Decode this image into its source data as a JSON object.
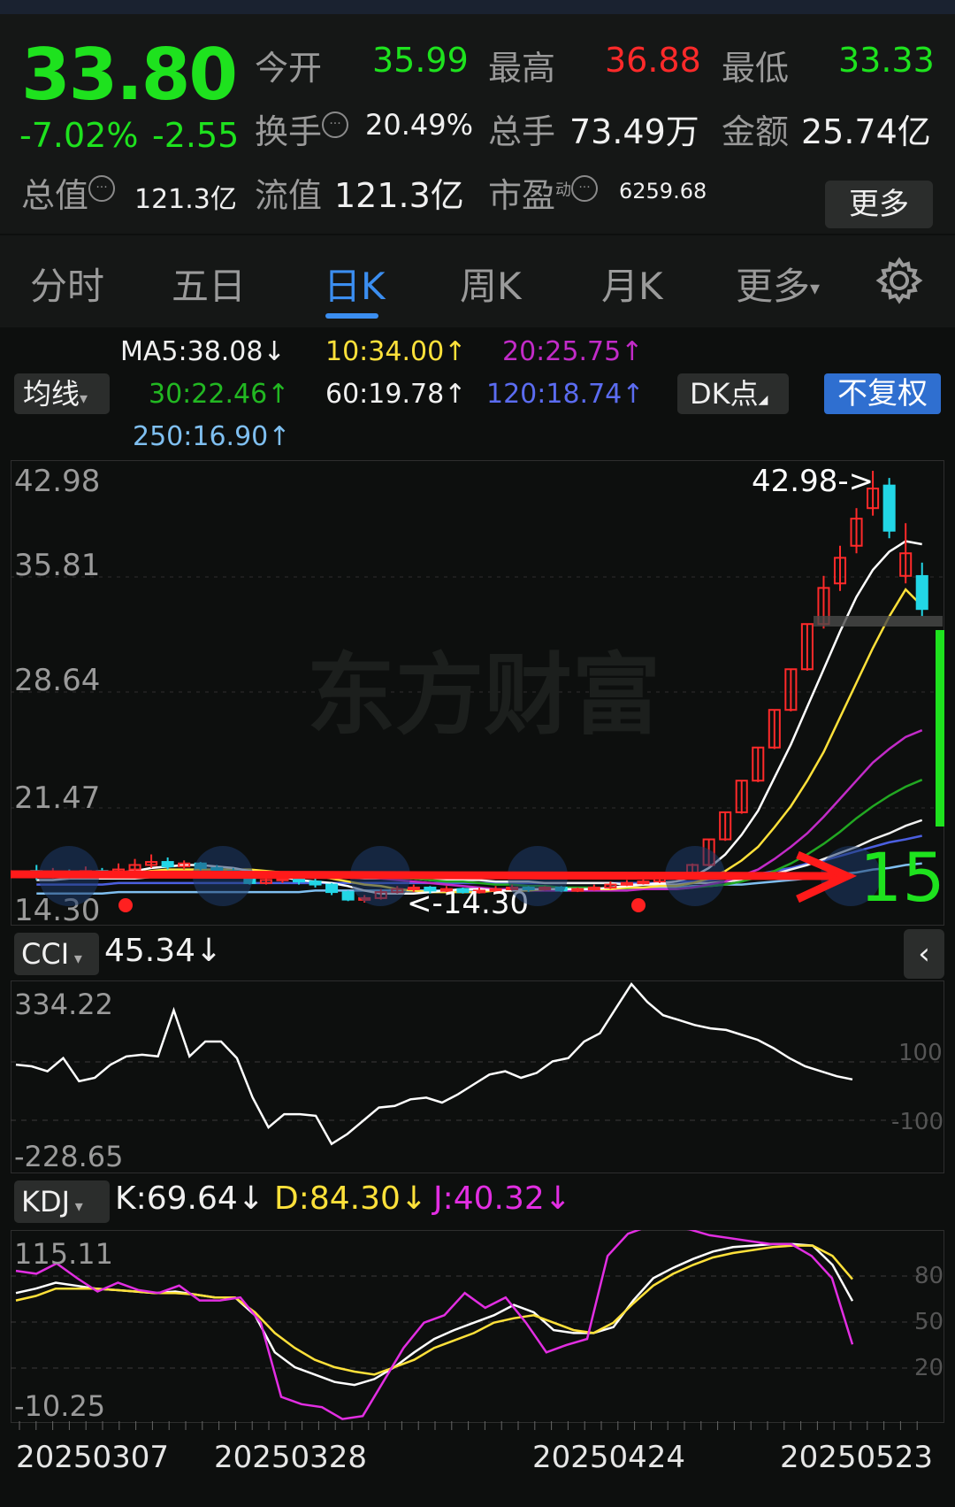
{
  "quote": {
    "price": "33.80",
    "change_pct": "-7.02%",
    "change_amt": "-2.55",
    "open_label": "今开",
    "open_value": "35.99",
    "high_label": "最高",
    "high_value": "36.88",
    "low_label": "最低",
    "low_value": "33.33",
    "turnover_label": "换手",
    "turnover_value": "20.49%",
    "volume_label": "总手",
    "volume_value": "73.49万",
    "amount_label": "金额",
    "amount_value": "25.74亿",
    "mktcap_label": "总值",
    "mktcap_value": "121.3亿",
    "float_label": "流值",
    "float_value": "121.3亿",
    "pe_label": "市盈",
    "pe_sup": "动",
    "pe_value": "6259.68",
    "more_button": "更多"
  },
  "tabs": [
    {
      "label": "分时"
    },
    {
      "label": "五日"
    },
    {
      "label": "日K"
    },
    {
      "label": "周K"
    },
    {
      "label": "月K"
    },
    {
      "label": "更多"
    }
  ],
  "active_tab": "日K",
  "ma": {
    "selector": "均线",
    "ma5": "MA5:38.08↓",
    "ma10": "10:34.00↑",
    "ma20": "20:25.75↑",
    "ma30": "30:22.46↑",
    "ma60": "60:19.78↑",
    "ma120": "120:18.74↑",
    "ma250": "250:16.90↑",
    "dk_button": "DK点",
    "rights_button": "不复权"
  },
  "colors": {
    "up": "#ff2a2a",
    "down": "#22d6e6",
    "ma5": "#ffffff",
    "ma10": "#ffe13a",
    "ma20": "#c22bc8",
    "ma30": "#22a822",
    "ma60": "#f0f0f0",
    "ma120": "#4b5fe0",
    "ma250": "#7fbff0",
    "accent": "#3b8ef0"
  },
  "main_chart": {
    "y_labels": [
      "42.98",
      "35.81",
      "28.64",
      "21.47",
      "14.30"
    ],
    "high_marker": "42.98->",
    "low_marker": "<-14.30",
    "watermark": "东方财富",
    "annotation": "15"
  },
  "cci": {
    "selector": "CCI",
    "value": "45.34↓",
    "y_max": "334.22",
    "y_min": "-228.65",
    "ref_high": "100",
    "ref_low": "-100"
  },
  "kdj": {
    "selector": "KDJ",
    "k": "K:69.64↓",
    "d": "D:84.30↓",
    "j": "J:40.32↓",
    "y_max": "115.11",
    "y_min": "-10.25",
    "ref_80": "80",
    "ref_50": "50",
    "ref_20": "20"
  },
  "dates": [
    "20250307",
    "20250328",
    "20250424",
    "20250523"
  ],
  "chart_data": [
    {
      "type": "candlestick",
      "title": "日K",
      "ylim": [
        14.3,
        42.98
      ],
      "x_labels": [
        "20250307",
        "20250328",
        "20250424",
        "20250523"
      ],
      "candles": [
        {
          "o": 16.4,
          "c": 16.0,
          "h": 16.8,
          "l": 15.8
        },
        {
          "o": 16.0,
          "c": 16.3,
          "h": 16.6,
          "l": 15.9
        },
        {
          "o": 16.3,
          "c": 16.1,
          "h": 16.5,
          "l": 15.9
        },
        {
          "o": 16.1,
          "c": 16.4,
          "h": 16.7,
          "l": 16.0
        },
        {
          "o": 16.4,
          "c": 16.2,
          "h": 16.6,
          "l": 16.0
        },
        {
          "o": 16.2,
          "c": 16.5,
          "h": 16.9,
          "l": 16.1
        },
        {
          "o": 16.5,
          "c": 16.8,
          "h": 17.2,
          "l": 16.4
        },
        {
          "o": 16.8,
          "c": 17.0,
          "h": 17.5,
          "l": 16.6
        },
        {
          "o": 17.0,
          "c": 16.7,
          "h": 17.3,
          "l": 16.5
        },
        {
          "o": 16.7,
          "c": 16.9,
          "h": 17.1,
          "l": 16.5
        },
        {
          "o": 16.9,
          "c": 16.6,
          "h": 17.0,
          "l": 16.4
        },
        {
          "o": 16.6,
          "c": 16.4,
          "h": 16.8,
          "l": 16.2
        },
        {
          "o": 16.4,
          "c": 16.2,
          "h": 16.6,
          "l": 16.0
        },
        {
          "o": 16.2,
          "c": 15.6,
          "h": 16.3,
          "l": 15.5
        },
        {
          "o": 15.6,
          "c": 15.8,
          "h": 16.0,
          "l": 15.5
        },
        {
          "o": 15.8,
          "c": 15.9,
          "h": 16.1,
          "l": 15.6
        },
        {
          "o": 15.9,
          "c": 15.7,
          "h": 16.0,
          "l": 15.5
        },
        {
          "o": 15.7,
          "c": 15.5,
          "h": 15.9,
          "l": 15.3
        },
        {
          "o": 15.5,
          "c": 15.0,
          "h": 15.6,
          "l": 14.8
        },
        {
          "o": 15.0,
          "c": 14.5,
          "h": 15.1,
          "l": 14.4
        },
        {
          "o": 14.5,
          "c": 14.6,
          "h": 14.8,
          "l": 14.3
        },
        {
          "o": 14.6,
          "c": 15.0,
          "h": 15.2,
          "l": 14.5
        },
        {
          "o": 15.0,
          "c": 15.2,
          "h": 15.4,
          "l": 14.9
        },
        {
          "o": 15.2,
          "c": 15.3,
          "h": 15.5,
          "l": 15.0
        },
        {
          "o": 15.3,
          "c": 15.1,
          "h": 15.4,
          "l": 14.9
        },
        {
          "o": 15.1,
          "c": 15.2,
          "h": 15.4,
          "l": 15.0
        },
        {
          "o": 15.2,
          "c": 15.0,
          "h": 15.3,
          "l": 14.9
        },
        {
          "o": 15.0,
          "c": 15.1,
          "h": 15.3,
          "l": 14.9
        },
        {
          "o": 15.1,
          "c": 15.2,
          "h": 15.4,
          "l": 15.0
        },
        {
          "o": 15.2,
          "c": 15.3,
          "h": 15.5,
          "l": 15.1
        },
        {
          "o": 15.3,
          "c": 15.2,
          "h": 15.4,
          "l": 15.0
        },
        {
          "o": 15.2,
          "c": 15.3,
          "h": 15.4,
          "l": 15.1
        },
        {
          "o": 15.3,
          "c": 15.1,
          "h": 15.4,
          "l": 15.0
        },
        {
          "o": 15.1,
          "c": 15.2,
          "h": 15.3,
          "l": 15.0
        },
        {
          "o": 15.2,
          "c": 15.3,
          "h": 15.5,
          "l": 15.1
        },
        {
          "o": 15.3,
          "c": 15.5,
          "h": 15.7,
          "l": 15.2
        },
        {
          "o": 15.5,
          "c": 15.6,
          "h": 15.8,
          "l": 15.4
        },
        {
          "o": 15.6,
          "c": 15.7,
          "h": 15.9,
          "l": 15.5
        },
        {
          "o": 15.7,
          "c": 15.9,
          "h": 16.0,
          "l": 15.6
        },
        {
          "o": 15.9,
          "c": 16.0,
          "h": 16.2,
          "l": 15.8
        },
        {
          "o": 16.0,
          "c": 16.8,
          "h": 16.9,
          "l": 15.9
        },
        {
          "o": 16.8,
          "c": 18.5,
          "h": 18.5,
          "l": 16.7
        },
        {
          "o": 18.5,
          "c": 20.3,
          "h": 20.3,
          "l": 18.4
        },
        {
          "o": 20.3,
          "c": 22.4,
          "h": 22.4,
          "l": 20.2
        },
        {
          "o": 22.4,
          "c": 24.6,
          "h": 24.6,
          "l": 22.3
        },
        {
          "o": 24.6,
          "c": 27.1,
          "h": 27.1,
          "l": 24.5
        },
        {
          "o": 27.1,
          "c": 29.8,
          "h": 29.8,
          "l": 27.0
        },
        {
          "o": 29.8,
          "c": 32.8,
          "h": 32.8,
          "l": 29.7
        },
        {
          "o": 32.8,
          "c": 35.2,
          "h": 36.0,
          "l": 32.5
        },
        {
          "o": 35.5,
          "c": 37.2,
          "h": 38.0,
          "l": 35.0
        },
        {
          "o": 38.0,
          "c": 39.8,
          "h": 40.5,
          "l": 37.5
        },
        {
          "o": 40.5,
          "c": 41.8,
          "h": 42.98,
          "l": 40.0
        },
        {
          "o": 42.0,
          "c": 39.0,
          "h": 42.5,
          "l": 38.5
        },
        {
          "o": 36.0,
          "c": 37.5,
          "h": 39.5,
          "l": 35.5
        },
        {
          "o": 35.99,
          "c": 33.8,
          "h": 36.88,
          "l": 33.33
        }
      ],
      "ma5": [
        16.2,
        16.2,
        16.2,
        16.2,
        16.3,
        16.3,
        16.4,
        16.6,
        16.7,
        16.8,
        16.8,
        16.7,
        16.6,
        16.4,
        16.2,
        16.0,
        15.8,
        15.7,
        15.6,
        15.4,
        15.1,
        14.9,
        14.9,
        14.9,
        15.0,
        15.1,
        15.2,
        15.2,
        15.1,
        15.1,
        15.2,
        15.2,
        15.2,
        15.2,
        15.2,
        15.3,
        15.4,
        15.5,
        15.6,
        15.7,
        16.0,
        16.6,
        17.5,
        18.8,
        20.4,
        22.6,
        24.8,
        27.3,
        29.8,
        32.3,
        34.6,
        36.4,
        37.6,
        38.3,
        38.1
      ],
      "ma10": [
        16.2,
        16.2,
        16.2,
        16.2,
        16.2,
        16.2,
        16.3,
        16.4,
        16.5,
        16.5,
        16.5,
        16.5,
        16.5,
        16.5,
        16.4,
        16.3,
        16.2,
        16.1,
        15.9,
        15.7,
        15.5,
        15.4,
        15.2,
        15.1,
        15.0,
        15.0,
        15.0,
        15.0,
        15.1,
        15.1,
        15.1,
        15.2,
        15.2,
        15.2,
        15.2,
        15.2,
        15.3,
        15.3,
        15.4,
        15.4,
        15.6,
        15.9,
        16.4,
        17.1,
        18.0,
        19.3,
        20.7,
        22.4,
        24.3,
        26.6,
        28.9,
        31.2,
        33.3,
        35.1,
        34.0
      ],
      "ma20": [
        16.1,
        16.1,
        16.1,
        16.1,
        16.2,
        16.2,
        16.2,
        16.2,
        16.3,
        16.3,
        16.3,
        16.3,
        16.3,
        16.3,
        16.3,
        16.3,
        16.3,
        16.2,
        16.2,
        16.1,
        16.0,
        15.9,
        15.8,
        15.7,
        15.6,
        15.5,
        15.4,
        15.3,
        15.2,
        15.2,
        15.1,
        15.1,
        15.1,
        15.1,
        15.1,
        15.1,
        15.1,
        15.2,
        15.2,
        15.2,
        15.3,
        15.5,
        15.7,
        16.1,
        16.5,
        17.2,
        18.0,
        18.9,
        20.0,
        21.2,
        22.4,
        23.6,
        24.5,
        25.3,
        25.75
      ],
      "ma30": [
        16.0,
        16.0,
        16.0,
        16.1,
        16.1,
        16.1,
        16.1,
        16.2,
        16.2,
        16.2,
        16.2,
        16.2,
        16.2,
        16.2,
        16.2,
        16.2,
        16.2,
        16.2,
        16.1,
        16.1,
        16.0,
        16.0,
        15.9,
        15.9,
        15.8,
        15.7,
        15.7,
        15.6,
        15.5,
        15.5,
        15.4,
        15.4,
        15.3,
        15.3,
        15.3,
        15.2,
        15.2,
        15.2,
        15.2,
        15.2,
        15.3,
        15.4,
        15.5,
        15.7,
        16.0,
        16.4,
        16.9,
        17.5,
        18.2,
        19.0,
        19.9,
        20.7,
        21.4,
        22.0,
        22.46
      ],
      "ma60": [
        15.8,
        15.8,
        15.9,
        15.9,
        15.9,
        15.9,
        15.9,
        16.0,
        16.0,
        16.0,
        16.0,
        16.0,
        16.0,
        16.0,
        16.0,
        16.0,
        16.0,
        16.0,
        16.0,
        16.0,
        15.9,
        15.9,
        15.9,
        15.9,
        15.8,
        15.8,
        15.8,
        15.8,
        15.7,
        15.7,
        15.7,
        15.6,
        15.6,
        15.6,
        15.6,
        15.6,
        15.5,
        15.5,
        15.5,
        15.5,
        15.6,
        15.6,
        15.7,
        15.8,
        16.0,
        16.2,
        16.5,
        16.8,
        17.2,
        17.6,
        18.0,
        18.5,
        18.9,
        19.4,
        19.78
      ],
      "ma120": [
        15.5,
        15.5,
        15.5,
        15.5,
        15.5,
        15.6,
        15.6,
        15.6,
        15.6,
        15.6,
        15.6,
        15.6,
        15.6,
        15.6,
        15.6,
        15.6,
        15.6,
        15.6,
        15.6,
        15.6,
        15.6,
        15.6,
        15.6,
        15.6,
        15.6,
        15.6,
        15.6,
        15.6,
        15.6,
        15.6,
        15.6,
        15.6,
        15.6,
        15.6,
        15.6,
        15.6,
        15.6,
        15.6,
        15.6,
        15.7,
        15.7,
        15.8,
        15.9,
        16.0,
        16.2,
        16.4,
        16.6,
        16.9,
        17.1,
        17.4,
        17.7,
        18.0,
        18.3,
        18.5,
        18.74
      ],
      "ma250": [
        14.9,
        14.9,
        14.9,
        14.9,
        14.9,
        15.0,
        15.0,
        15.0,
        15.0,
        15.0,
        15.0,
        15.0,
        15.0,
        15.0,
        15.0,
        15.0,
        15.0,
        15.1,
        15.1,
        15.1,
        15.1,
        15.1,
        15.1,
        15.1,
        15.1,
        15.1,
        15.1,
        15.2,
        15.2,
        15.2,
        15.2,
        15.2,
        15.2,
        15.2,
        15.2,
        15.3,
        15.3,
        15.3,
        15.3,
        15.3,
        15.4,
        15.4,
        15.5,
        15.5,
        15.6,
        15.7,
        15.8,
        15.9,
        16.0,
        16.2,
        16.3,
        16.5,
        16.6,
        16.8,
        16.9
      ]
    },
    {
      "type": "line",
      "title": "CCI",
      "ylim": [
        -228.65,
        334.22
      ],
      "series": [
        {
          "name": "CCI",
          "values": [
            90,
            85,
            70,
            110,
            40,
            50,
            90,
            115,
            120,
            115,
            255,
            115,
            160,
            160,
            110,
            -10,
            -100,
            -60,
            -60,
            -65,
            -150,
            -120,
            -80,
            -40,
            -35,
            -15,
            -10,
            -25,
            0,
            30,
            60,
            70,
            50,
            65,
            100,
            110,
            160,
            185,
            260,
            334,
            280,
            240,
            225,
            210,
            200,
            195,
            180,
            165,
            140,
            110,
            85,
            70,
            55,
            45.34
          ]
        }
      ]
    },
    {
      "type": "line",
      "title": "KDJ",
      "ylim": [
        -10.25,
        115.11
      ],
      "series": [
        {
          "name": "K",
          "values": [
            75,
            78,
            82,
            80,
            78,
            77,
            76,
            75,
            76,
            74,
            72,
            72,
            60,
            35,
            25,
            20,
            15,
            13,
            17,
            25,
            35,
            44,
            50,
            55,
            60,
            67,
            62,
            50,
            48,
            48,
            52,
            70,
            85,
            92,
            98,
            103,
            106,
            107,
            108,
            108,
            107,
            94,
            69.64
          ]
        },
        {
          "name": "D",
          "values": [
            70,
            73,
            78,
            78,
            78,
            77,
            76,
            75,
            75,
            74,
            72,
            72,
            62,
            48,
            38,
            30,
            25,
            22,
            20,
            25,
            30,
            38,
            43,
            48,
            55,
            58,
            60,
            55,
            50,
            48,
            55,
            68,
            80,
            88,
            94,
            99,
            102,
            104,
            106,
            107,
            107,
            100,
            84.3
          ]
        },
        {
          "name": "J",
          "values": [
            90,
            88,
            95,
            85,
            76,
            82,
            77,
            75,
            80,
            70,
            70,
            72,
            55,
            5,
            0,
            -2,
            -10,
            -8,
            15,
            38,
            55,
            60,
            75,
            65,
            72,
            55,
            35,
            40,
            44,
            100,
            115,
            120,
            120,
            118,
            114,
            112,
            110,
            108,
            108,
            100,
            85,
            40.32
          ]
        }
      ]
    }
  ]
}
